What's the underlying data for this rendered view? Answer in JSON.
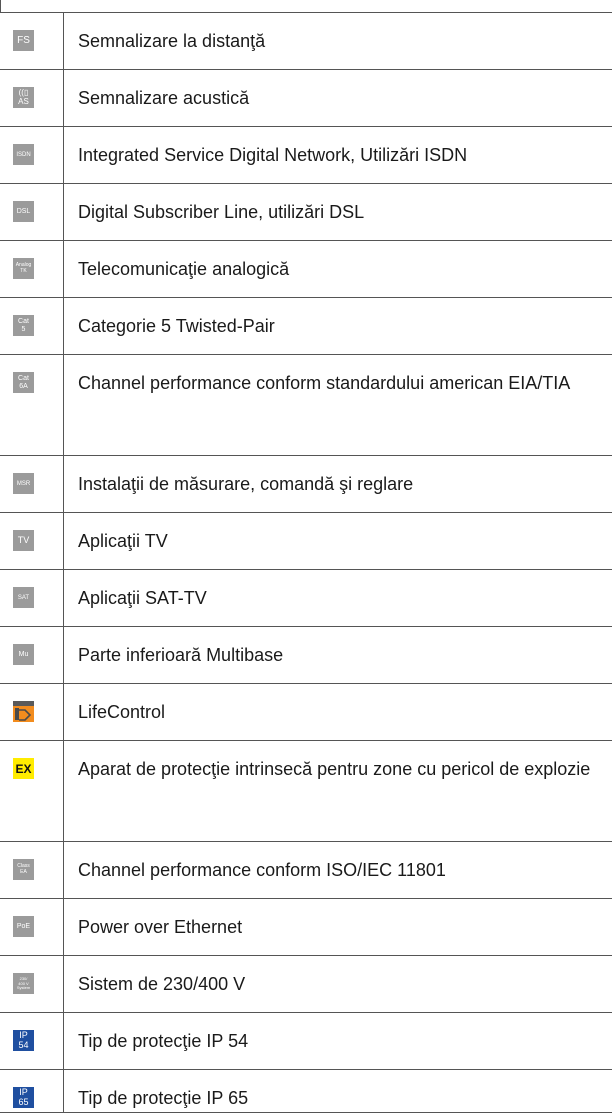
{
  "legend": {
    "rows": [
      {
        "icon": "fs-icon",
        "icon_line1": "FS",
        "icon_line2": "",
        "icon_bg": "#9b9b9b",
        "icon_fg": "#ffffff",
        "text": "Semnalizare la distanţă"
      },
      {
        "icon": "acoustic-signal-icon",
        "icon_line1": "((▯",
        "icon_line2": "AS",
        "icon_bg": "#9b9b9b",
        "icon_fg": "#ffffff",
        "text": "Semnalizare acustică"
      },
      {
        "icon": "isdn-icon",
        "icon_line1": "ISDN",
        "icon_line2": "",
        "icon_bg": "#9b9b9b",
        "icon_fg": "#ffffff",
        "text": "Integrated Service Digital Network, Utilizări ISDN"
      },
      {
        "icon": "dsl-icon",
        "icon_line1": "DSL",
        "icon_line2": "",
        "icon_bg": "#9b9b9b",
        "icon_fg": "#ffffff",
        "text": "Digital Subscriber Line, utilizări DSL"
      },
      {
        "icon": "analog-tk-icon",
        "icon_line1": "Analog",
        "icon_line2": "TK",
        "icon_bg": "#9b9b9b",
        "icon_fg": "#ffffff",
        "text": "Telecomunicaţie analogică"
      },
      {
        "icon": "cat5-icon",
        "icon_line1": "Cat",
        "icon_line2": "5",
        "icon_bg": "#9b9b9b",
        "icon_fg": "#ffffff",
        "text": "Categorie 5 Twisted-Pair"
      },
      {
        "icon": "cat6a-icon",
        "icon_line1": "Cat",
        "icon_line2": "6A",
        "icon_bg": "#9b9b9b",
        "icon_fg": "#ffffff",
        "text": "Channel performance conform standardului american EIA/TIA"
      },
      {
        "icon": "msr-icon",
        "icon_line1": "MSR",
        "icon_line2": "",
        "icon_bg": "#9b9b9b",
        "icon_fg": "#ffffff",
        "text": "Instalaţii de măsurare, comandă şi reglare"
      },
      {
        "icon": "tv-icon",
        "icon_line1": "TV",
        "icon_line2": "",
        "icon_bg": "#9b9b9b",
        "icon_fg": "#ffffff",
        "text": "Aplicaţii TV"
      },
      {
        "icon": "sat-icon",
        "icon_line1": "SAT",
        "icon_line2": "",
        "icon_bg": "#9b9b9b",
        "icon_fg": "#ffffff",
        "text": "Aplicaţii SAT-TV"
      },
      {
        "icon": "multibase-icon",
        "icon_line1": "Mu",
        "icon_line2": "",
        "icon_bg": "#9b9b9b",
        "icon_fg": "#ffffff",
        "text": "Parte inferioară Multibase"
      },
      {
        "icon": "lifecontrol-icon",
        "icon_line1": "",
        "icon_line2": "",
        "icon_bg": "#9b9b9b",
        "icon_fg": "#ffffff",
        "text": "LifeControl"
      },
      {
        "icon": "ex-icon",
        "icon_line1": "EX",
        "icon_line2": "",
        "icon_bg": "#ffec00",
        "icon_fg": "#111111",
        "text": "Aparat de protecţie intrinsecă pentru zone cu pericol de explozie"
      },
      {
        "icon": "class-ea-icon",
        "icon_line1": "Class",
        "icon_line2": "EA",
        "icon_bg": "#9b9b9b",
        "icon_fg": "#ffffff",
        "text": "Channel performance conform ISO/IEC 11801"
      },
      {
        "icon": "poe-icon",
        "icon_line1": "PoE",
        "icon_line2": "",
        "icon_bg": "#9b9b9b",
        "icon_fg": "#ffffff",
        "text": "Power over Ethernet"
      },
      {
        "icon": "system-230-400v-icon",
        "icon_line1": "230/",
        "icon_line2": "400 V System",
        "icon_bg": "#9b9b9b",
        "icon_fg": "#ffffff",
        "text": "Sistem de 230/400 V"
      },
      {
        "icon": "ip54-icon",
        "icon_line1": "IP",
        "icon_line2": "54",
        "icon_bg": "#1f4fa0",
        "icon_fg": "#ffffff",
        "text": "Tip de protecţie IP 54"
      },
      {
        "icon": "ip65-icon",
        "icon_line1": "IP",
        "icon_line2": "65",
        "icon_bg": "#1f4fa0",
        "icon_fg": "#ffffff",
        "text": "Tip de protecţie IP 65"
      }
    ]
  }
}
